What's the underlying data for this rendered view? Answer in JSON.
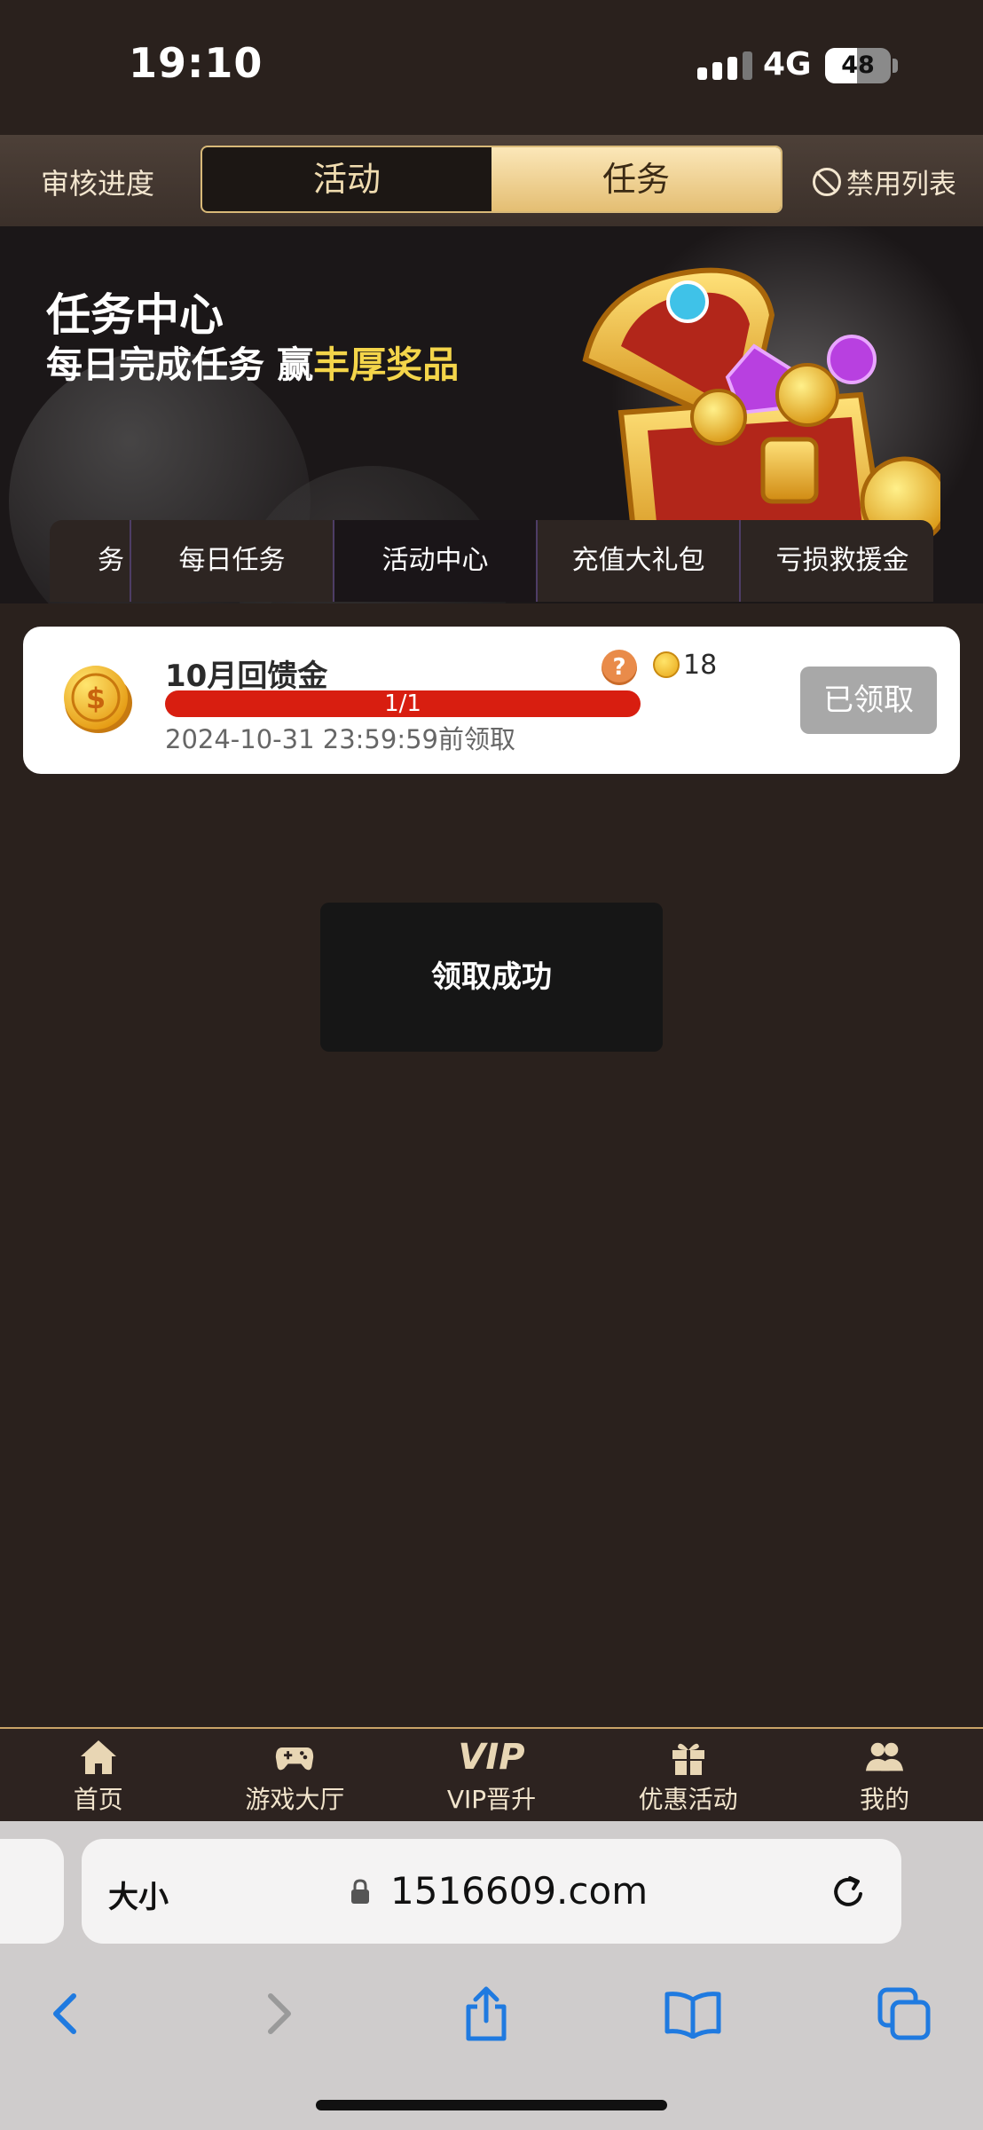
{
  "status_bar": {
    "time": "19:10",
    "network": "4G",
    "battery": "48"
  },
  "top_nav": {
    "left": "审核进度",
    "tabs": [
      {
        "label": "活动"
      },
      {
        "label": "任务"
      }
    ],
    "right": "禁用列表"
  },
  "banner": {
    "title": "任务中心",
    "subtitle_prefix": "每日完成任务 赢",
    "subtitle_highlight": "丰厚奖品"
  },
  "sub_tabs": [
    "务",
    "每日任务",
    "活动中心",
    "充值大礼包",
    "亏损救援金"
  ],
  "task": {
    "title": "10月回馈金",
    "reward": "18",
    "progress_label": "1/1",
    "progress_fraction": 1.0,
    "deadline": "2024-10-31 23:59:59前领取",
    "button": "已领取"
  },
  "toast": "领取成功",
  "bottom_tabs": [
    "首页",
    "游戏大厅",
    "VIP晋升",
    "优惠活动",
    "我的"
  ],
  "vip_logo_text": "VIP",
  "browser": {
    "text_size": "大小",
    "url": "1516609.com"
  },
  "colors": {
    "accent_gold": "#e4be73",
    "progress_red": "#d81e10",
    "highlight_yellow": "#f4d54a"
  }
}
